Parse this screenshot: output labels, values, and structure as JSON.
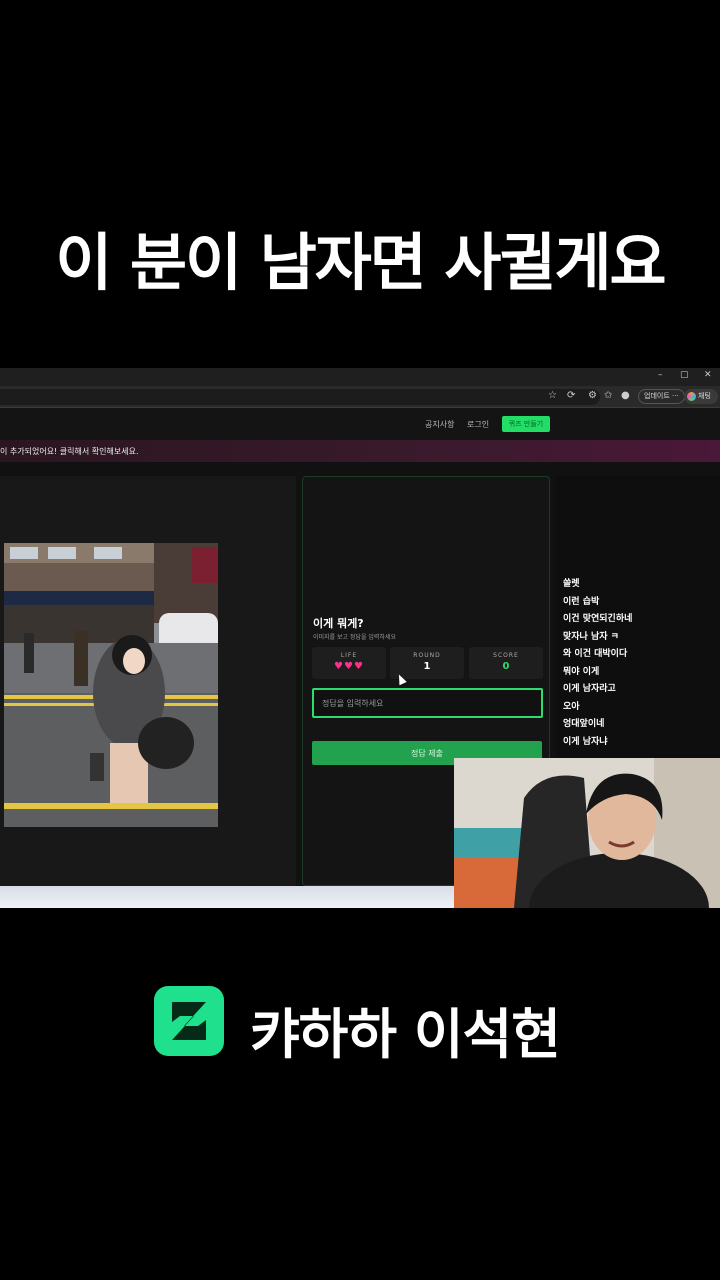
{
  "caption": "이 분이 남자면 사귈게요",
  "browser": {
    "min_symbol": "–",
    "restore_symbol": "▢",
    "close_symbol": "✕",
    "update_label": "업데이트 ···",
    "chat_label": "채팅"
  },
  "site_nav": {
    "notice": "공지사항",
    "login": "로그인",
    "make_quiz": "퀴즈 만들기"
  },
  "banner_text": "이 추가되었어요! 클릭해서 확인해보세요.",
  "quiz": {
    "title": "이게 뭐게?",
    "subtitle": "이미지를 보고 정답을 입력하세요",
    "life_label": "LIFE",
    "hearts": "♥♥♥",
    "round_label": "ROUND",
    "round_value": "1",
    "score_label": "SCORE",
    "score_value": "0",
    "answer_placeholder": "정답을 입력하세요",
    "submit_label": "정답 제출"
  },
  "chat_messages": [
    "쓸렛",
    "이런 습박",
    "이건 맞연되긴하네",
    "맞자나 남자 ㅋ",
    "와 이건 대박이다",
    "뭐야 이게",
    "이게 남자라고",
    "오아",
    "엉대앞이네",
    "이게 남자냐"
  ],
  "brand": {
    "name": "캬하하 이석현",
    "logo_letter": "Z",
    "color": "#1fe08c"
  },
  "colors": {
    "accent_green": "#2bdc6e",
    "heart_pink": "#ff2e8a"
  }
}
